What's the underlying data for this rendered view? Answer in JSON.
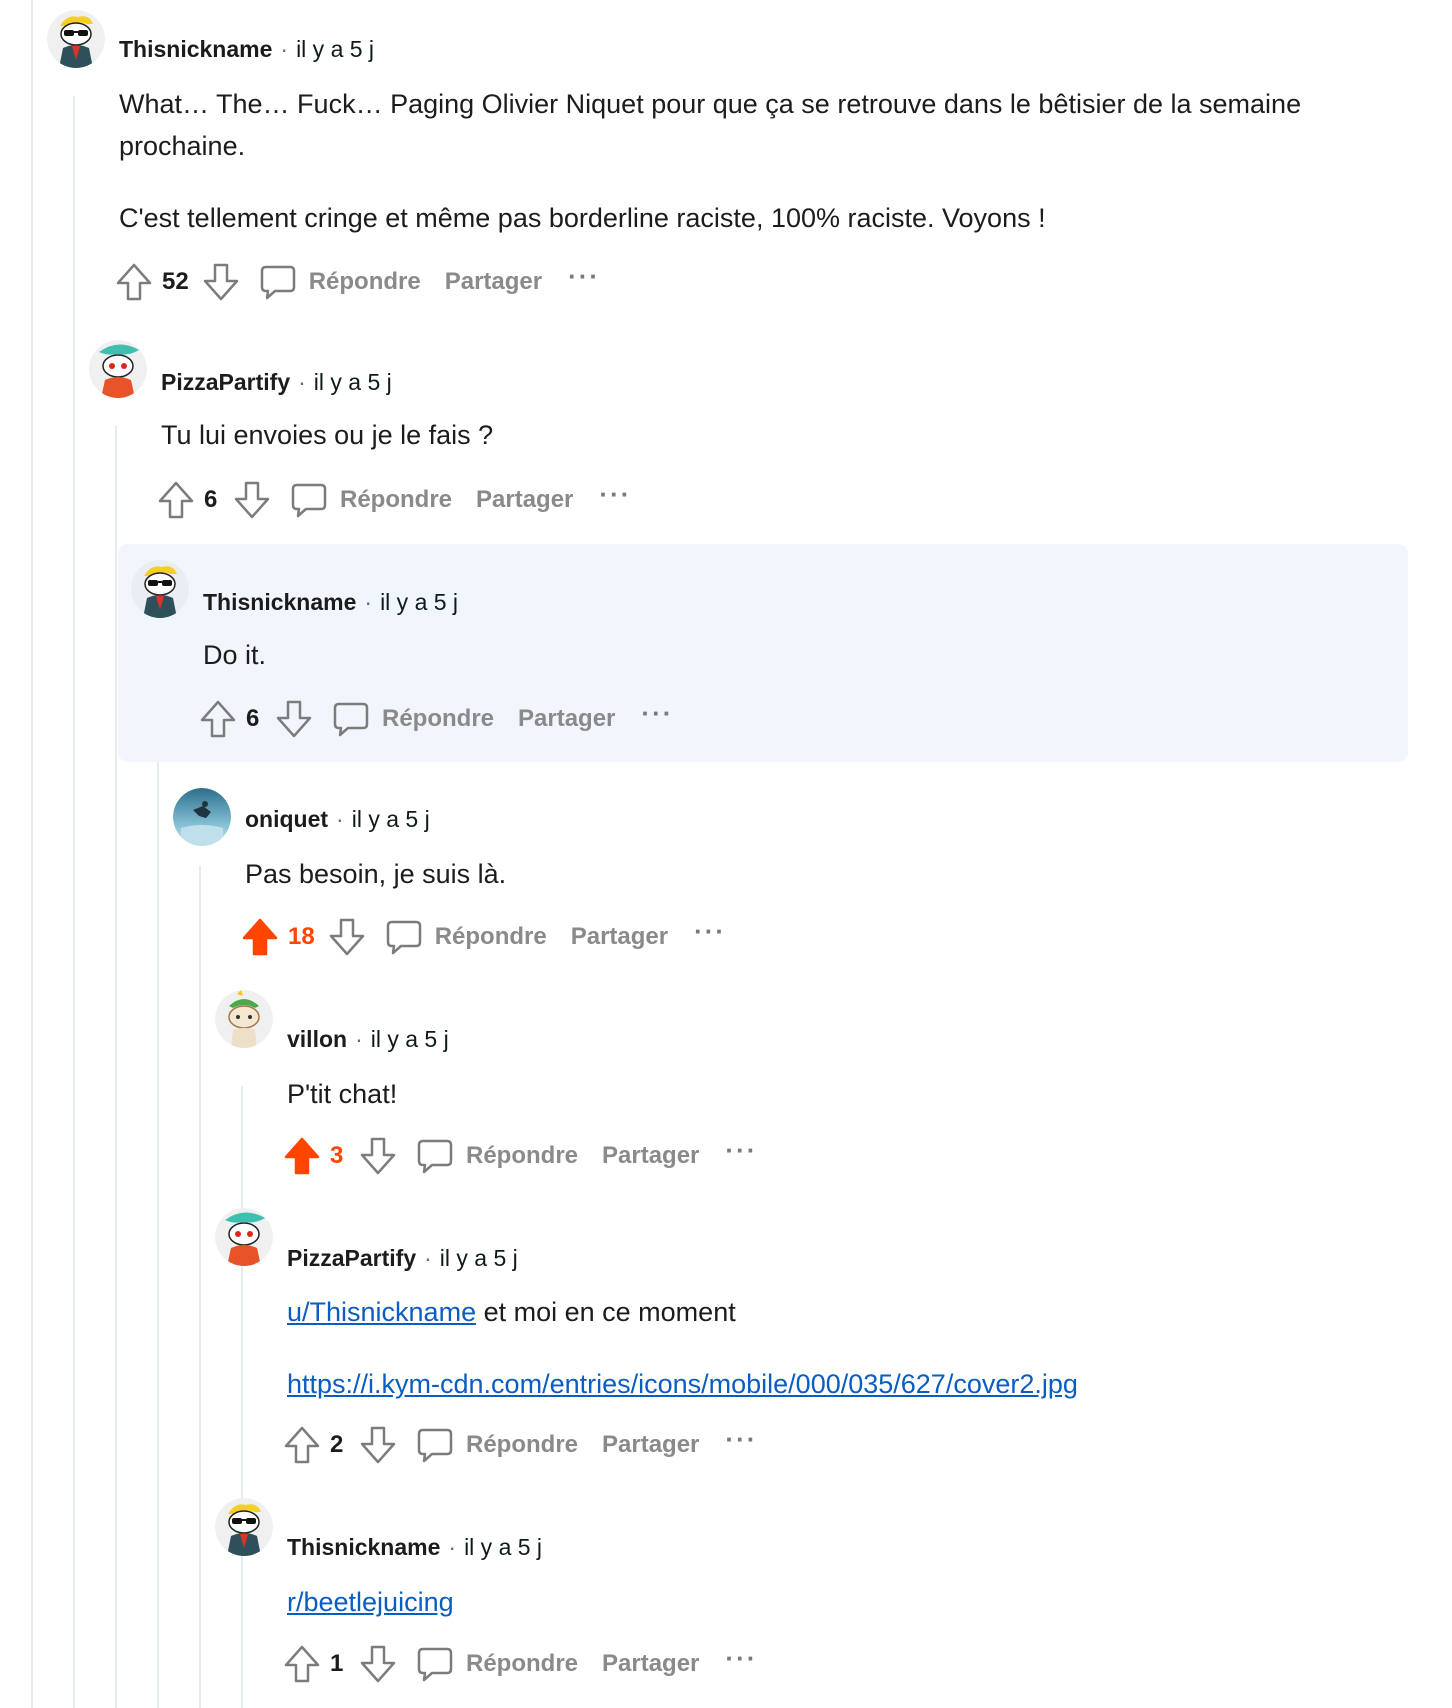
{
  "comments": [
    {
      "author": "Thisnickname",
      "time": "il y a 5 j",
      "paragraphs": [
        "What… The… Fuck… Paging Olivier Niquet pour que ça se retrouve dans le bêtisier de la semaine prochaine.",
        "C'est tellement cringe et même pas borderline raciste, 100% raciste. Voyons !"
      ],
      "score": "52",
      "upvoted": false,
      "avatar_icon": "snoo-sunglasses-avatar"
    },
    {
      "author": "PizzaPartify",
      "time": "il y a 5 j",
      "paragraphs": [
        "Tu lui envoies ou je le fais ?"
      ],
      "score": "6",
      "upvoted": false,
      "avatar_icon": "snoo-shark-hat-avatar"
    },
    {
      "author": "Thisnickname",
      "time": "il y a 5 j",
      "paragraphs": [
        "Do it."
      ],
      "score": "6",
      "upvoted": false,
      "highlighted": true,
      "avatar_icon": "snoo-sunglasses-avatar"
    },
    {
      "author": "oniquet",
      "time": "il y a 5 j",
      "paragraphs": [
        "Pas besoin, je suis là."
      ],
      "score": "18",
      "upvoted": true,
      "avatar_icon": "photo-avatar"
    },
    {
      "author": "villon",
      "time": "il y a 5 j",
      "paragraphs": [
        "P'tit chat!"
      ],
      "score": "3",
      "upvoted": true,
      "avatar_icon": "snoo-cat-hat-avatar"
    },
    {
      "author": "PizzaPartify",
      "time": "il y a 5 j",
      "mention": "u/Thisnickname",
      "mention_suffix": " et moi en ce moment",
      "url": "https://i.kym-cdn.com/entries/icons/mobile/000/035/627/cover2.jpg",
      "score": "2",
      "upvoted": false,
      "avatar_icon": "snoo-shark-hat-avatar"
    },
    {
      "author": "Thisnickname",
      "time": "il y a 5 j",
      "subreddit_link": "r/beetlejuicing",
      "score": "1",
      "upvoted": false,
      "avatar_icon": "snoo-sunglasses-avatar"
    }
  ],
  "labels": {
    "separator": "·",
    "reply": "Répondre",
    "share": "Partager",
    "more": "···"
  },
  "colors": {
    "upvote_active": "#ff4500",
    "link": "#0a5dc2",
    "highlight": "#f0f6fb",
    "thread_line": "#e5ebee"
  }
}
